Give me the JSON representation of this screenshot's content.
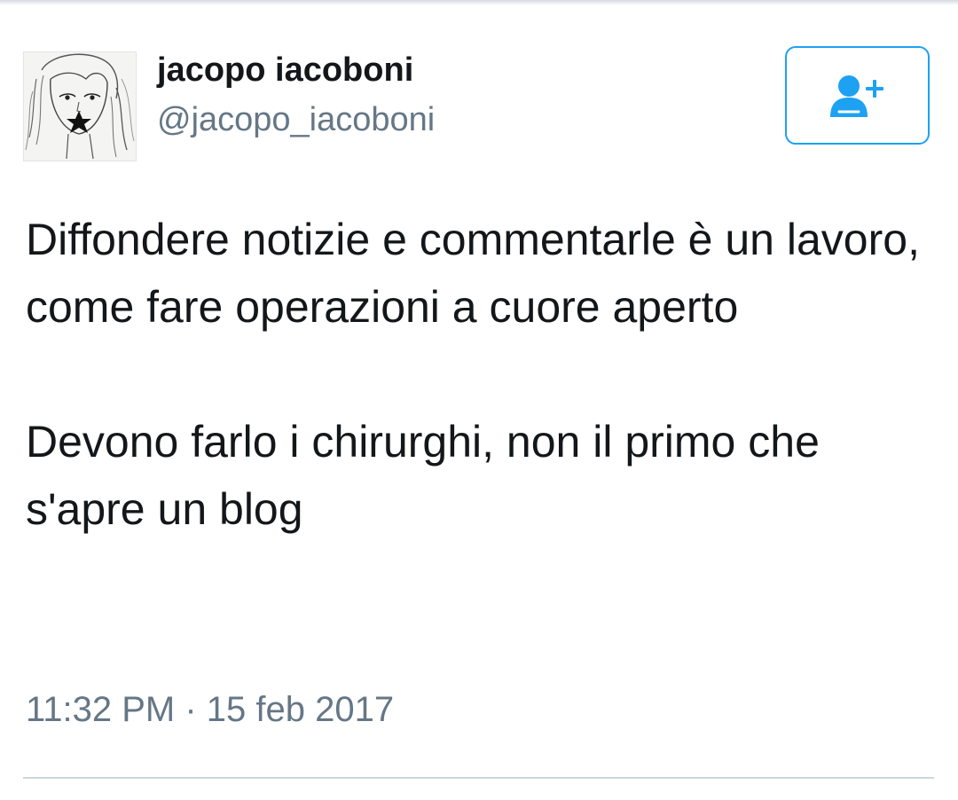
{
  "tweet": {
    "author": {
      "display_name": "jacopo iacoboni",
      "handle": "@jacopo_iacoboni",
      "avatar_icon": "sketch-portrait"
    },
    "follow_button_icon": "add-user-icon",
    "text": "Diffondere notizie e commentarle è un lavoro, come fare operazioni a cuore aperto\n\nDevono farlo i chirurghi, non il primo che s'apre un blog",
    "timestamp": "11:32 PM · 15 feb 2017"
  },
  "colors": {
    "accent": "#1da1f2",
    "text_primary": "#14171a",
    "text_secondary": "#657786",
    "divider": "#ccd6dd"
  }
}
